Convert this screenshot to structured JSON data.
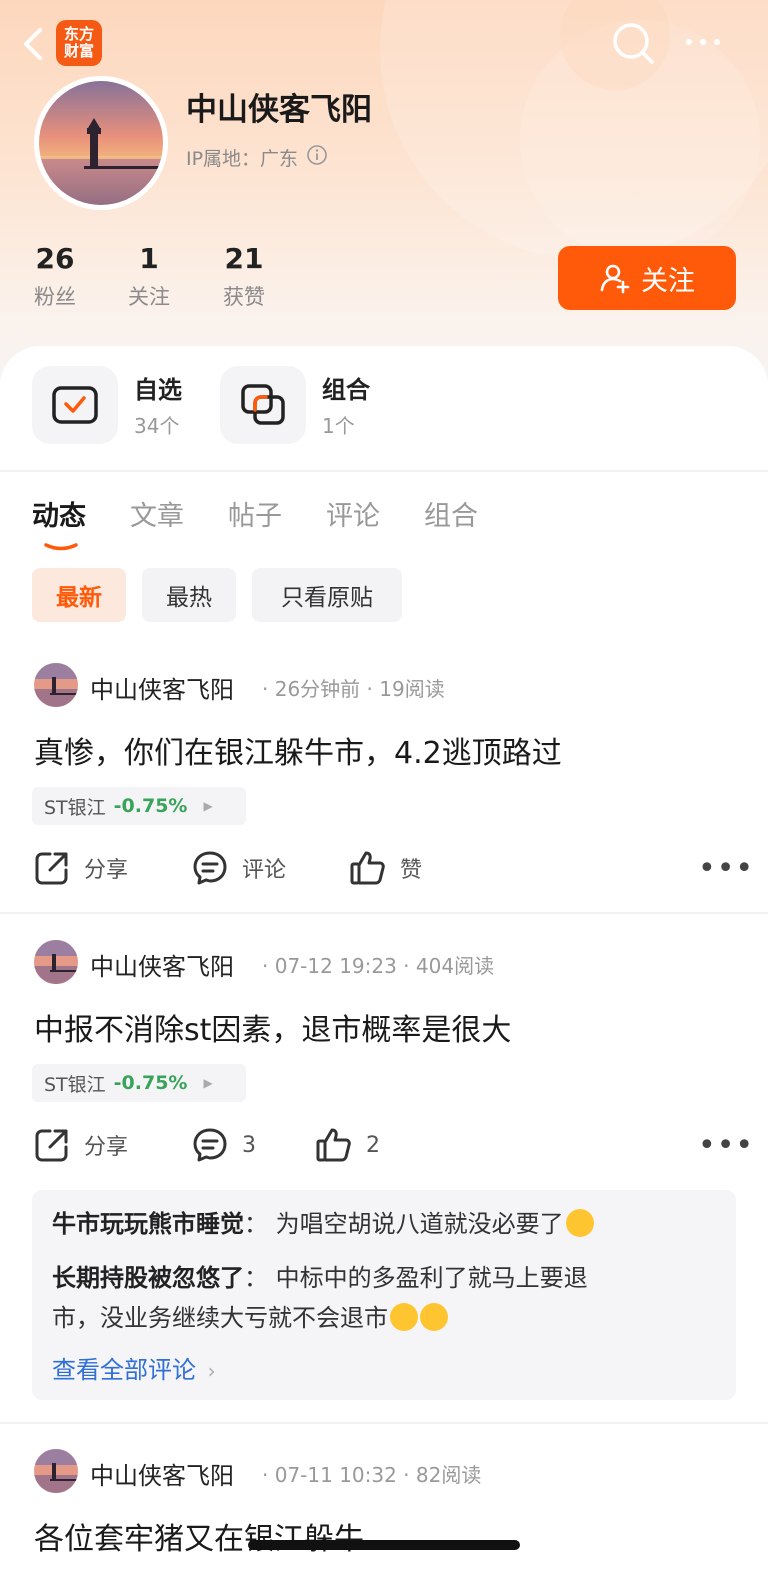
{
  "header": {
    "logo_line1": "东方",
    "logo_line2": "财富",
    "user_name": "中山侠客飞阳",
    "ip_label": "IP属地：广东",
    "follow_button": "关注"
  },
  "stats": [
    {
      "value": "26",
      "label": "粉丝"
    },
    {
      "value": "1",
      "label": "关注"
    },
    {
      "value": "21",
      "label": "获赞"
    }
  ],
  "shortcuts": [
    {
      "title": "自选",
      "sub": "34个"
    },
    {
      "title": "组合",
      "sub": "1个"
    }
  ],
  "tabs": [
    "动态",
    "文章",
    "帖子",
    "评论",
    "组合"
  ],
  "filters": [
    "最新",
    "最热",
    "只看原贴"
  ],
  "posts": [
    {
      "author": "中山侠客飞阳",
      "time": "26分钟前",
      "reads": "19阅读",
      "text": "真惨，你们在银江躲牛市，4.2逃顶路过",
      "stock_name": "ST银江",
      "stock_change": "-0.75%",
      "share": "分享",
      "comment": "评论",
      "like": "赞"
    },
    {
      "author": "中山侠客飞阳",
      "time": "07-12 19:23",
      "reads": "404阅读",
      "text": "中报不消除st因素，退市概率是很大",
      "stock_name": "ST银江",
      "stock_change": "-0.75%",
      "share": "分享",
      "comment": "3",
      "like": "2",
      "comments": [
        {
          "user": "牛市玩玩熊市睡觉",
          "sep": "：",
          "text": "为唱空胡说八道就没必要了"
        },
        {
          "user": "长期持股被忽悠了",
          "sep": "：",
          "text": "中标中的多盈利了就马上要退",
          "text2": "市，没业务继续大亏就不会退市"
        }
      ],
      "view_all": "查看全部评论"
    },
    {
      "author": "中山侠客飞阳",
      "time": "07-11 10:32",
      "reads": "82阅读",
      "text": "各位套牢猪又在银江躲牛"
    }
  ],
  "colors": {
    "accent": "#ff5a0a",
    "stock_green": "#3aa35b",
    "link_blue": "#2f6fd6"
  }
}
